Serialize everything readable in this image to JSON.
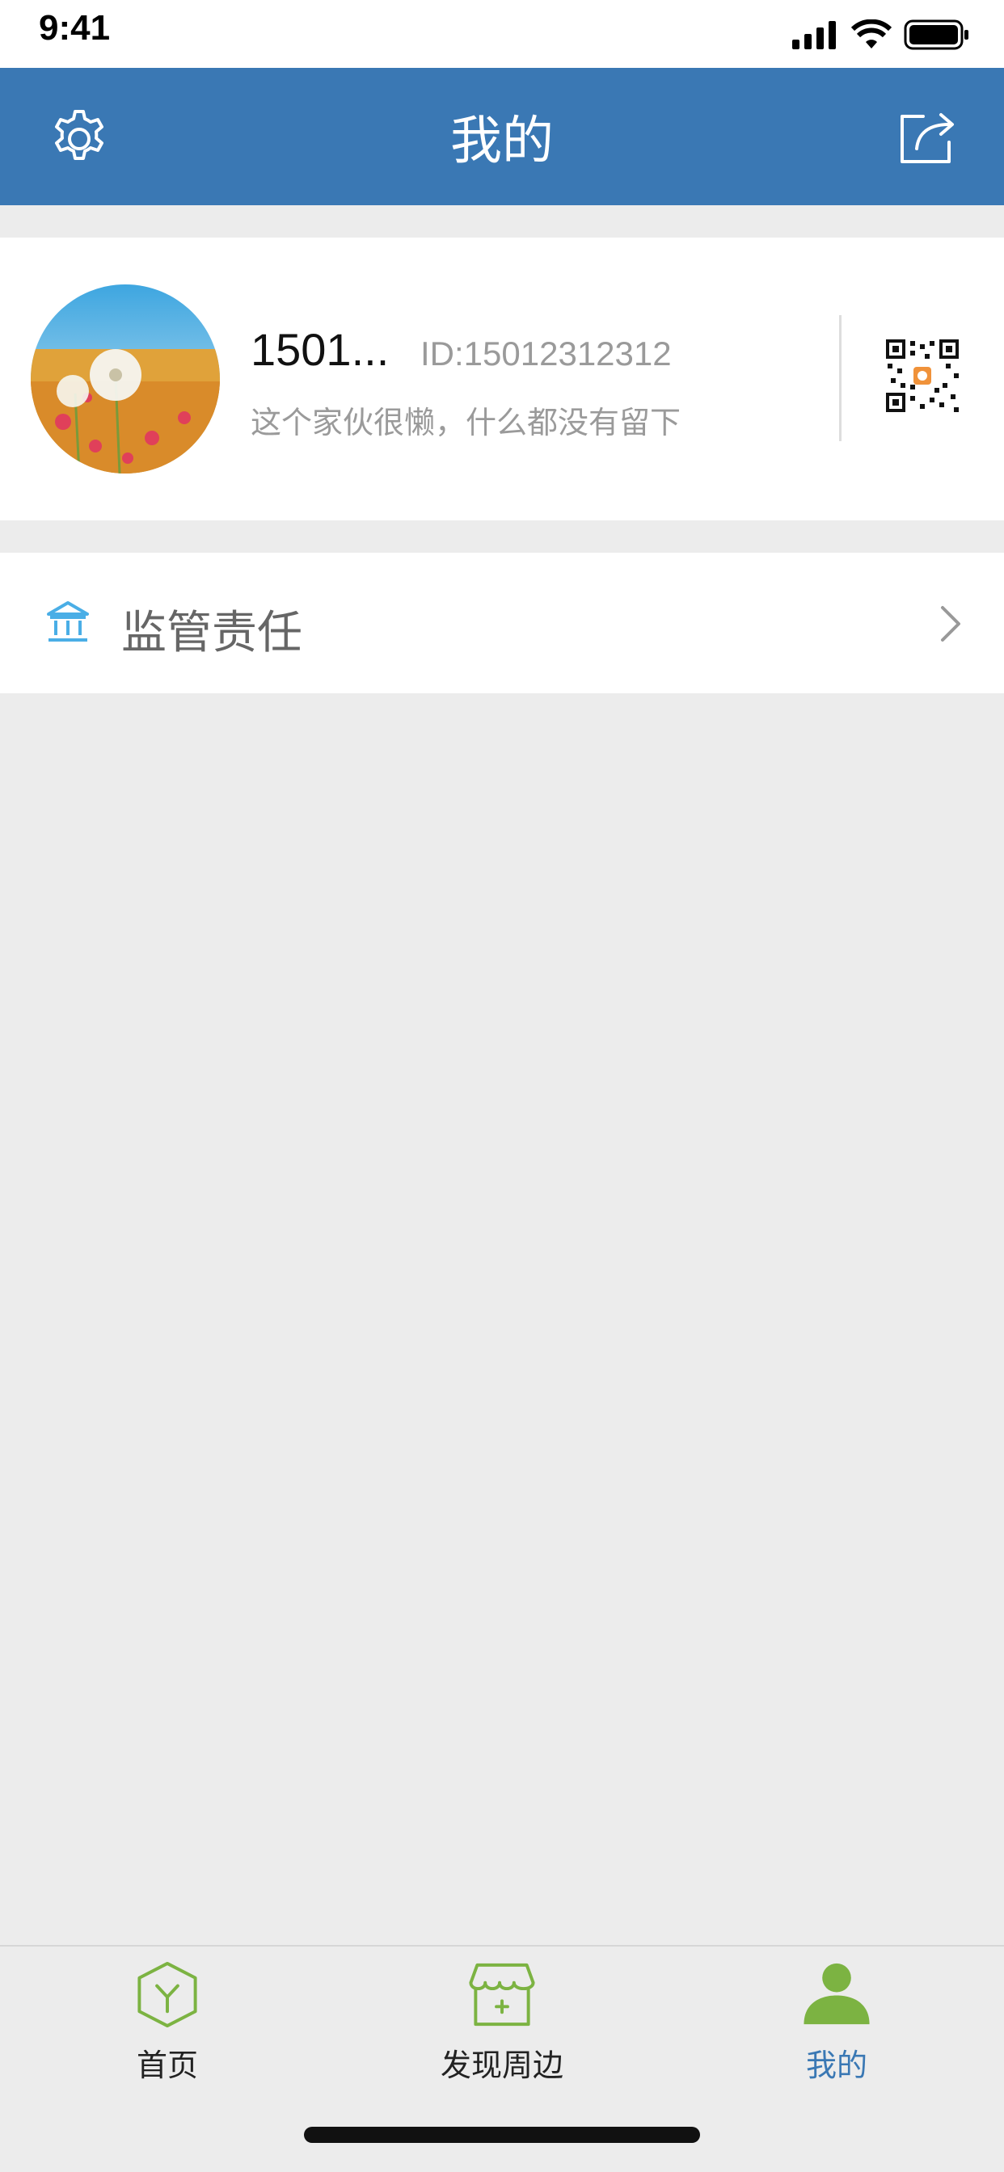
{
  "status_bar": {
    "time": "9:41"
  },
  "header": {
    "title": "我的",
    "left_icon": "gear-icon",
    "right_icon": "share-icon"
  },
  "profile": {
    "name": "1501...",
    "id_text": "ID:15012312312",
    "bio": "这个家伙很懒，什么都没有留下",
    "qr_icon": "qr-code-icon"
  },
  "menu": {
    "items": [
      {
        "label": "监管责任",
        "icon": "bank-icon"
      }
    ]
  },
  "tabbar": {
    "tabs": [
      {
        "label": "首页",
        "icon": "hexagon-icon"
      },
      {
        "label": "发现周边",
        "icon": "store-icon"
      },
      {
        "label": "我的",
        "icon": "user-icon",
        "active": true
      }
    ]
  },
  "colors": {
    "primary": "#3a78b4",
    "accent_green": "#7cb342",
    "background": "#ececec"
  }
}
